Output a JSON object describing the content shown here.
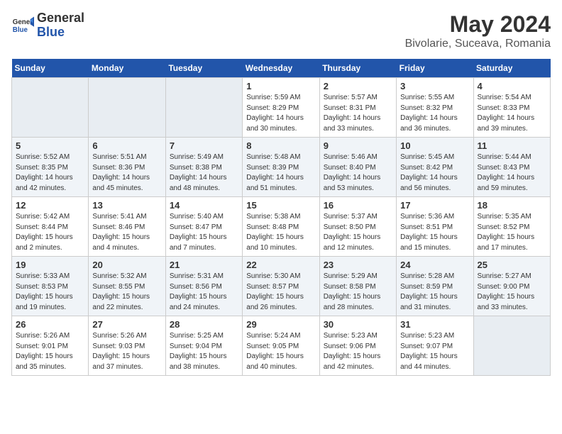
{
  "header": {
    "logo_line1": "General",
    "logo_line2": "Blue",
    "title": "May 2024",
    "subtitle": "Bivolarie, Suceava, Romania"
  },
  "days_of_week": [
    "Sunday",
    "Monday",
    "Tuesday",
    "Wednesday",
    "Thursday",
    "Friday",
    "Saturday"
  ],
  "weeks": [
    [
      {
        "day": "",
        "empty": true
      },
      {
        "day": "",
        "empty": true
      },
      {
        "day": "",
        "empty": true
      },
      {
        "day": "1",
        "sunrise": "5:59 AM",
        "sunset": "8:29 PM",
        "daylight": "14 hours and 30 minutes."
      },
      {
        "day": "2",
        "sunrise": "5:57 AM",
        "sunset": "8:31 PM",
        "daylight": "14 hours and 33 minutes."
      },
      {
        "day": "3",
        "sunrise": "5:55 AM",
        "sunset": "8:32 PM",
        "daylight": "14 hours and 36 minutes."
      },
      {
        "day": "4",
        "sunrise": "5:54 AM",
        "sunset": "8:33 PM",
        "daylight": "14 hours and 39 minutes."
      }
    ],
    [
      {
        "day": "5",
        "sunrise": "5:52 AM",
        "sunset": "8:35 PM",
        "daylight": "14 hours and 42 minutes."
      },
      {
        "day": "6",
        "sunrise": "5:51 AM",
        "sunset": "8:36 PM",
        "daylight": "14 hours and 45 minutes."
      },
      {
        "day": "7",
        "sunrise": "5:49 AM",
        "sunset": "8:38 PM",
        "daylight": "14 hours and 48 minutes."
      },
      {
        "day": "8",
        "sunrise": "5:48 AM",
        "sunset": "8:39 PM",
        "daylight": "14 hours and 51 minutes."
      },
      {
        "day": "9",
        "sunrise": "5:46 AM",
        "sunset": "8:40 PM",
        "daylight": "14 hours and 53 minutes."
      },
      {
        "day": "10",
        "sunrise": "5:45 AM",
        "sunset": "8:42 PM",
        "daylight": "14 hours and 56 minutes."
      },
      {
        "day": "11",
        "sunrise": "5:44 AM",
        "sunset": "8:43 PM",
        "daylight": "14 hours and 59 minutes."
      }
    ],
    [
      {
        "day": "12",
        "sunrise": "5:42 AM",
        "sunset": "8:44 PM",
        "daylight": "15 hours and 2 minutes."
      },
      {
        "day": "13",
        "sunrise": "5:41 AM",
        "sunset": "8:46 PM",
        "daylight": "15 hours and 4 minutes."
      },
      {
        "day": "14",
        "sunrise": "5:40 AM",
        "sunset": "8:47 PM",
        "daylight": "15 hours and 7 minutes."
      },
      {
        "day": "15",
        "sunrise": "5:38 AM",
        "sunset": "8:48 PM",
        "daylight": "15 hours and 10 minutes."
      },
      {
        "day": "16",
        "sunrise": "5:37 AM",
        "sunset": "8:50 PM",
        "daylight": "15 hours and 12 minutes."
      },
      {
        "day": "17",
        "sunrise": "5:36 AM",
        "sunset": "8:51 PM",
        "daylight": "15 hours and 15 minutes."
      },
      {
        "day": "18",
        "sunrise": "5:35 AM",
        "sunset": "8:52 PM",
        "daylight": "15 hours and 17 minutes."
      }
    ],
    [
      {
        "day": "19",
        "sunrise": "5:33 AM",
        "sunset": "8:53 PM",
        "daylight": "15 hours and 19 minutes."
      },
      {
        "day": "20",
        "sunrise": "5:32 AM",
        "sunset": "8:55 PM",
        "daylight": "15 hours and 22 minutes."
      },
      {
        "day": "21",
        "sunrise": "5:31 AM",
        "sunset": "8:56 PM",
        "daylight": "15 hours and 24 minutes."
      },
      {
        "day": "22",
        "sunrise": "5:30 AM",
        "sunset": "8:57 PM",
        "daylight": "15 hours and 26 minutes."
      },
      {
        "day": "23",
        "sunrise": "5:29 AM",
        "sunset": "8:58 PM",
        "daylight": "15 hours and 28 minutes."
      },
      {
        "day": "24",
        "sunrise": "5:28 AM",
        "sunset": "8:59 PM",
        "daylight": "15 hours and 31 minutes."
      },
      {
        "day": "25",
        "sunrise": "5:27 AM",
        "sunset": "9:00 PM",
        "daylight": "15 hours and 33 minutes."
      }
    ],
    [
      {
        "day": "26",
        "sunrise": "5:26 AM",
        "sunset": "9:01 PM",
        "daylight": "15 hours and 35 minutes."
      },
      {
        "day": "27",
        "sunrise": "5:26 AM",
        "sunset": "9:03 PM",
        "daylight": "15 hours and 37 minutes."
      },
      {
        "day": "28",
        "sunrise": "5:25 AM",
        "sunset": "9:04 PM",
        "daylight": "15 hours and 38 minutes."
      },
      {
        "day": "29",
        "sunrise": "5:24 AM",
        "sunset": "9:05 PM",
        "daylight": "15 hours and 40 minutes."
      },
      {
        "day": "30",
        "sunrise": "5:23 AM",
        "sunset": "9:06 PM",
        "daylight": "15 hours and 42 minutes."
      },
      {
        "day": "31",
        "sunrise": "5:23 AM",
        "sunset": "9:07 PM",
        "daylight": "15 hours and 44 minutes."
      },
      {
        "day": "",
        "empty": true
      }
    ]
  ]
}
